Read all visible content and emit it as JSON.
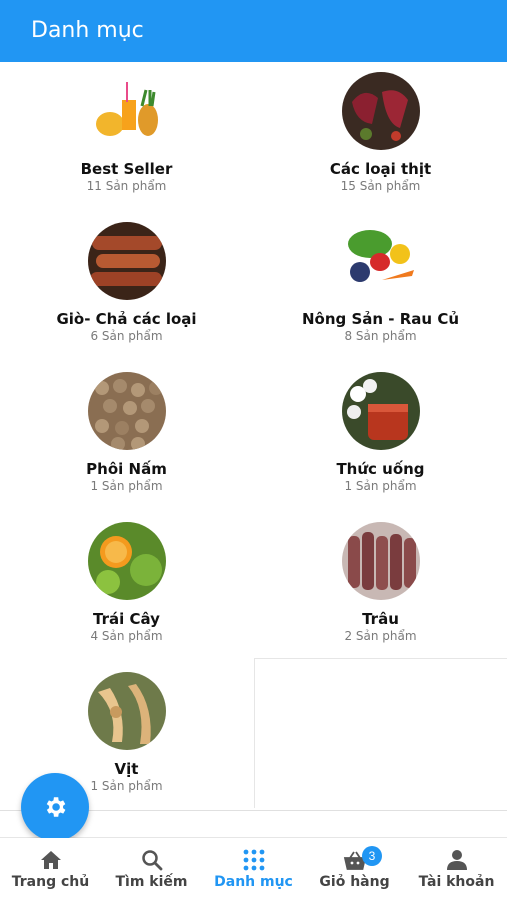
{
  "header": {
    "title": "Danh mục"
  },
  "categories": [
    {
      "name": "Best Seller",
      "count": "11 Sản phẩm",
      "icon": "juice-fruits-image"
    },
    {
      "name": "Các loại thịt",
      "count": "15 Sản phẩm",
      "icon": "meat-image"
    },
    {
      "name": "Giò- Chả các loại",
      "count": "6 Sản phẩm",
      "icon": "sausage-image"
    },
    {
      "name": "Nông Sản - Rau Củ",
      "count": "8 Sản phẩm",
      "icon": "vegetables-image"
    },
    {
      "name": "Phôi Nấm",
      "count": "1 Sản phẩm",
      "icon": "mushroom-spawn-image"
    },
    {
      "name": "Thức uống",
      "count": "1 Sản phẩm",
      "icon": "drink-image"
    },
    {
      "name": "Trái Cây",
      "count": "4 Sản phẩm",
      "icon": "fruit-image"
    },
    {
      "name": "Trâu",
      "count": "2 Sản phẩm",
      "icon": "buffalo-meat-image"
    },
    {
      "name": "Vịt",
      "count": "1 Sản phẩm",
      "icon": "duck-image"
    }
  ],
  "fab": {
    "icon": "settings-gear-icon"
  },
  "nav": {
    "items": [
      {
        "label": "Trang chủ",
        "icon": "home-icon"
      },
      {
        "label": "Tìm kiếm",
        "icon": "search-icon"
      },
      {
        "label": "Danh mục",
        "icon": "grid-icon"
      },
      {
        "label": "Giỏ hàng",
        "icon": "cart-icon",
        "badge": "3"
      },
      {
        "label": "Tài khoản",
        "icon": "user-icon"
      }
    ],
    "active_color": "#2196f3"
  }
}
